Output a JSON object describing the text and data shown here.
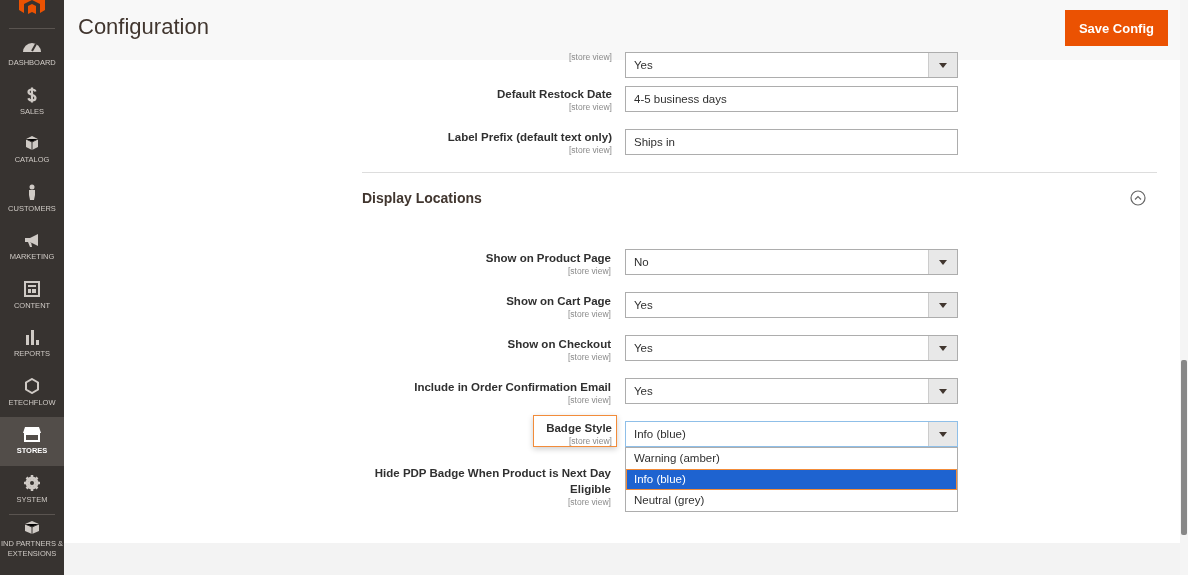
{
  "sidebar": {
    "items": [
      {
        "label": "DASHBOARD",
        "selected": false
      },
      {
        "label": "SALES",
        "selected": false
      },
      {
        "label": "CATALOG",
        "selected": false
      },
      {
        "label": "CUSTOMERS",
        "selected": false
      },
      {
        "label": "MARKETING",
        "selected": false
      },
      {
        "label": "CONTENT",
        "selected": false
      },
      {
        "label": "REPORTS",
        "selected": false
      },
      {
        "label": "ETECHFLOW",
        "selected": false
      },
      {
        "label": "STORES",
        "selected": true
      },
      {
        "label": "SYSTEM",
        "selected": false
      },
      {
        "label": "IND PARTNERS & EXTENSIONS",
        "selected": false
      }
    ]
  },
  "header": {
    "title": "Configuration",
    "save_button": "Save Config"
  },
  "fields": [
    {
      "kind": "select",
      "scope": "[store view]",
      "value": "Yes"
    },
    {
      "kind": "text",
      "label": "Default Restock Date",
      "scope": "[store view]",
      "value": "4-5 business days"
    },
    {
      "kind": "text",
      "label": "Label Prefix (default text only)",
      "scope": "[store view]",
      "value": "Ships in"
    }
  ],
  "section": {
    "title": "Display Locations",
    "expanded": true,
    "fields": [
      {
        "kind": "select",
        "label": "Show on Product Page",
        "scope": "[store view]",
        "value": "No",
        "highlighted": false
      },
      {
        "kind": "select",
        "label": "Show on Cart Page",
        "scope": "[store view]",
        "value": "Yes",
        "highlighted": false
      },
      {
        "kind": "select",
        "label": "Show on Checkout",
        "scope": "[store view]",
        "value": "Yes",
        "highlighted": false
      },
      {
        "kind": "select",
        "label": "Include in Order Confirmation Email",
        "scope": "[store view]",
        "value": "Yes",
        "highlighted": false
      },
      {
        "kind": "select",
        "label": "Badge Style",
        "scope": "[store view]",
        "value": "Info (blue)",
        "highlighted": true,
        "open": true,
        "options": [
          {
            "label": "Warning (amber)",
            "selected": false
          },
          {
            "label": "Info (blue)",
            "selected": true
          },
          {
            "label": "Neutral (grey)",
            "selected": false
          }
        ]
      },
      {
        "kind": "covered",
        "label": "Hide PDP Badge When Product is Next Day Eligible",
        "scope": "[store view]",
        "highlighted": false
      }
    ]
  }
}
